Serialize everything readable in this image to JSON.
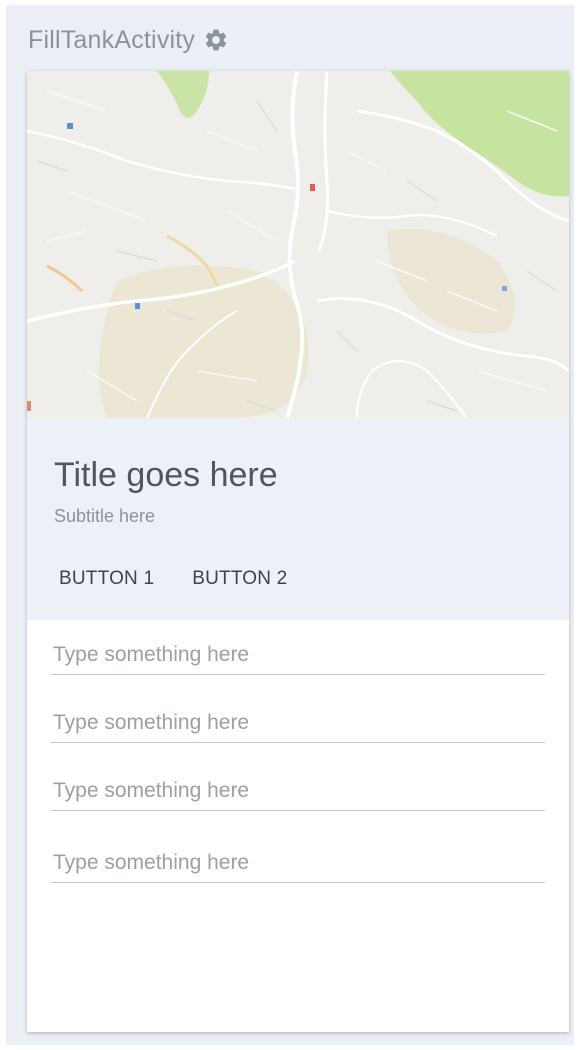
{
  "app": {
    "title": "FillTankActivity",
    "settings_icon": "gear-icon"
  },
  "card": {
    "title": "Title goes here",
    "subtitle": "Subtitle here",
    "button1": "BUTTON 1",
    "button2": "BUTTON 2",
    "map_icon": "map-image"
  },
  "fields": [
    {
      "placeholder": "Type something here",
      "value": ""
    },
    {
      "placeholder": "Type something here",
      "value": ""
    },
    {
      "placeholder": "Type something here",
      "value": ""
    },
    {
      "placeholder": "Type something here",
      "value": ""
    }
  ],
  "colors": {
    "background": "#ebeff5",
    "card_header": "#edf1f7",
    "map_park": "#c6e3a0",
    "field_underline": "#c2c8d6"
  }
}
